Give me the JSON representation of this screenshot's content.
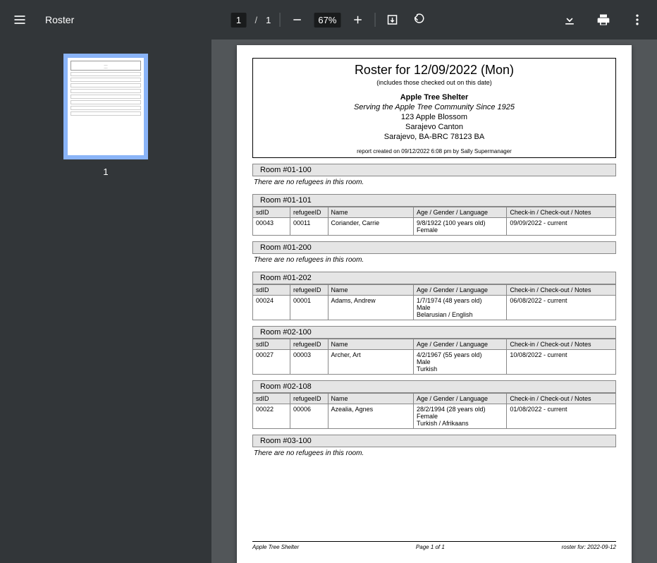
{
  "toolbar": {
    "title": "Roster",
    "currentPage": "1",
    "totalPages": "1",
    "zoom": "67%"
  },
  "thumb": {
    "label": "1"
  },
  "doc": {
    "title": "Roster for 12/09/2022 (Mon)",
    "subtitle": "(includes those checked out on this date)",
    "shelterName": "Apple Tree Shelter",
    "motto": "Serving the Apple Tree Community Since 1925",
    "addr1": "123 Apple Blossom",
    "addr2": "Sarajevo Canton",
    "addr3": "Sarajevo, BA-BRC 78123 BA",
    "reportMeta": "report created on 09/12/2022 6:08 pm by Sally Supermanager",
    "columns": {
      "sdid": "sdID",
      "refid": "refugeeID",
      "name": "Name",
      "age": "Age / Gender / Language",
      "check": "Check-in / Check-out / Notes"
    },
    "emptyMsg": "There are no refugees in this room.",
    "rooms": [
      {
        "name": "Room #01-100",
        "empty": true
      },
      {
        "name": "Room #01-101",
        "rows": [
          {
            "sdid": "00043",
            "refid": "00011",
            "name": "Coriander, Carrie",
            "age": "9/8/1922 (100 years old)\nFemale",
            "check": "09/09/2022 - current"
          }
        ]
      },
      {
        "name": "Room #01-200",
        "empty": true
      },
      {
        "name": "Room #01-202",
        "rows": [
          {
            "sdid": "00024",
            "refid": "00001",
            "name": "Adams, Andrew",
            "age": "1/7/1974 (48 years old)\nMale\nBelarusian / English",
            "check": "06/08/2022 - current"
          }
        ]
      },
      {
        "name": "Room #02-100",
        "rows": [
          {
            "sdid": "00027",
            "refid": "00003",
            "name": "Archer, Art",
            "age": "4/2/1967 (55 years old)\nMale\nTurkish",
            "check": "10/08/2022 - current"
          }
        ]
      },
      {
        "name": "Room #02-108",
        "rows": [
          {
            "sdid": "00022",
            "refid": "00006",
            "name": "Azealia, Agnes",
            "age": "28/2/1994 (28 years old)\nFemale\nTurkish / Afrikaans",
            "check": "01/08/2022 - current"
          }
        ]
      },
      {
        "name": "Room #03-100",
        "empty": true
      }
    ],
    "footer": {
      "left": "Apple Tree Shelter",
      "center": "Page 1 of 1",
      "right": "roster for: 2022-09-12"
    }
  }
}
